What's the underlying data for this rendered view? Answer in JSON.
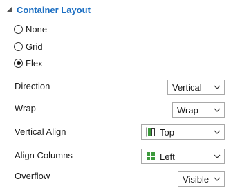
{
  "section": {
    "title": "Container Layout"
  },
  "layout_options": [
    {
      "label": "None",
      "checked": false
    },
    {
      "label": "Grid",
      "checked": false
    },
    {
      "label": "Flex",
      "checked": true
    }
  ],
  "properties": {
    "direction": {
      "label": "Direction",
      "value": "Vertical"
    },
    "wrap": {
      "label": "Wrap",
      "value": "Wrap"
    },
    "vertical_align": {
      "label": "Vertical Align",
      "value": "Top",
      "icon": "align-top-icon"
    },
    "align_columns": {
      "label": "Align Columns",
      "value": "Left",
      "icon": "align-left-columns-icon"
    },
    "overflow": {
      "label": "Overflow",
      "value": "Visible"
    }
  },
  "colors": {
    "accent": "#1b6ec2",
    "icon_green": "#3c9a3c"
  }
}
